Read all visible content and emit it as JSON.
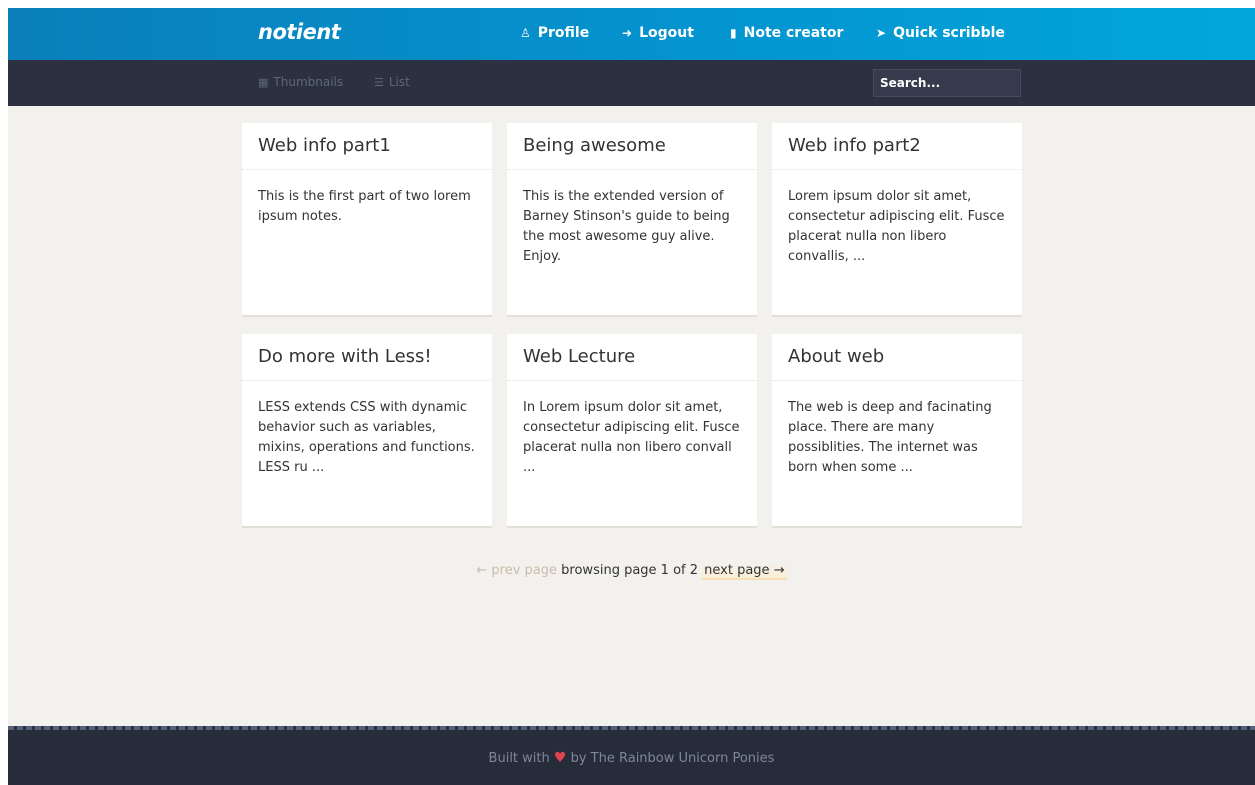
{
  "brand": "notient",
  "topnav": {
    "profile": {
      "icon": "user-icon",
      "label": "Profile"
    },
    "logout": {
      "icon": "logout-icon",
      "label": "Logout"
    },
    "note_creator": {
      "icon": "document-icon",
      "label": "Note creator"
    },
    "quick_scribble": {
      "icon": "rocket-icon",
      "label": "Quick scribble"
    }
  },
  "subbar": {
    "thumbnails_label": "Thumbnails",
    "list_label": "List",
    "search_placeholder": "Search..."
  },
  "notes": [
    {
      "title": "Web info part1",
      "excerpt": "This is the first part of two lorem ipsum notes."
    },
    {
      "title": "Being awesome",
      "excerpt": "This is the extended version of Barney Stinson's guide to being the most awesome guy alive. Enjoy."
    },
    {
      "title": "Web info part2",
      "excerpt": "Lorem ipsum dolor sit amet, consectetur adipiscing elit. Fusce placerat nulla non libero convallis, ..."
    },
    {
      "title": "Do more with Less!",
      "excerpt": "LESS extends CSS with dynamic behavior such as variables, mixins, operations and functions. LESS ru ..."
    },
    {
      "title": "Web Lecture",
      "excerpt": "In Lorem ipsum dolor sit amet, consectetur adipiscing elit. Fusce placerat nulla non libero convall ..."
    },
    {
      "title": "About web",
      "excerpt": "The web is deep and facinating place. There are many possiblities. The internet was born when some ..."
    }
  ],
  "pagination": {
    "prev": "← prev page",
    "status": "browsing page 1 of 2",
    "next": "next page →"
  },
  "footer": {
    "before": "Built with",
    "heart": "♥",
    "after": "by The Rainbow Unicorn Ponies"
  },
  "colors": {
    "header_blue": "#0494cf",
    "subbar_dark": "#2b3141",
    "page_bg": "#f3f1ed",
    "heart_red": "#e0444f"
  }
}
